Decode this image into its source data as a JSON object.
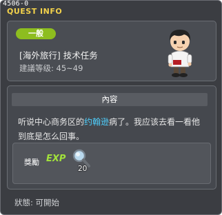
{
  "window": {
    "quest_id": "4506-0",
    "title": "QUEST INFO"
  },
  "quest": {
    "type_badge": "一般",
    "name": "[海外旅行] 技术任务",
    "level_label": "建議等级: 45~49"
  },
  "content": {
    "header": "內容",
    "text_before": "听说中心商务区的",
    "npc_name": "约翰逊",
    "text_after": "病了。我应该去看一看他到底是怎么回事。"
  },
  "reward": {
    "label": "獎勵",
    "exp_label": "EXP",
    "item_icon": "magnifying-glass-icon",
    "item_count": "20"
  },
  "status": {
    "text": "狀態: 可開始"
  },
  "colors": {
    "title": "#f3d24b",
    "badge": "#8dbd1f",
    "npc_highlight": "#4fd1ff",
    "exp": "#a2e23b"
  }
}
